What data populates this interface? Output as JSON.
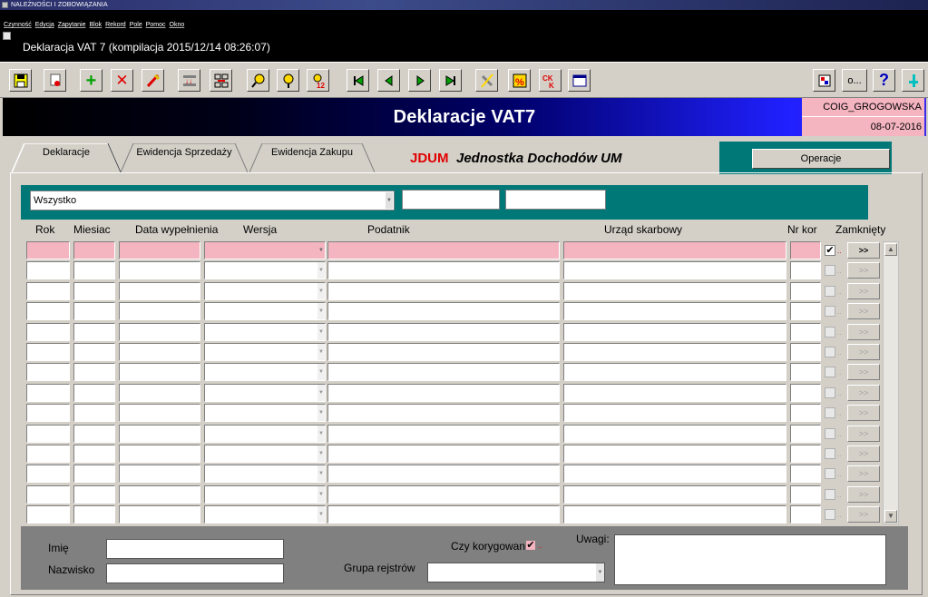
{
  "os_title": "NALEŻNOŚCI I ZOBOWIĄZANIA",
  "menu": [
    "Czynność",
    "Edycja",
    "Zapytanie",
    "Blok",
    "Rekord",
    "Pole",
    "Pomoc",
    "Okno"
  ],
  "window_title": "Deklaracja VAT 7 (kompilacja 2015/12/14 08:26:07)",
  "toolbar": {
    "buttons": [
      "save-icon",
      "print-icon",
      "add-icon",
      "delete-icon",
      "edit-icon",
      "insert-rows-icon",
      "clear-rows-icon",
      "search-icon",
      "search-alt-icon",
      "count-icon",
      "first-icon",
      "prev-icon",
      "next-icon",
      "last-icon",
      "pen-icon",
      "calc-icon",
      "ck-icon",
      "window-icon",
      "tool-icon"
    ],
    "right_label": "o...",
    "help": "?"
  },
  "banner": {
    "title": "Deklaracje VAT7",
    "user": "COIG_GROGOWSKA",
    "date": "08-07-2016"
  },
  "tabs": [
    {
      "label": "Deklaracje"
    },
    {
      "label": "Ewidencja Sprzedaży"
    },
    {
      "label": "Ewidencja Zakupu"
    }
  ],
  "org": {
    "code": "JDUM",
    "name": "Jednostka Dochodów UM"
  },
  "operations_label": "Operacje",
  "filter": {
    "selected": "Wszystko"
  },
  "columns": {
    "rok": "Rok",
    "miesiac": "Miesiac",
    "data": "Data wypełnienia",
    "wersja": "Wersja",
    "podatnik": "Podatnik",
    "urzad": "Urząd skarbowy",
    "nrkor": "Nr kor",
    "zamkniety": "Zamknięty"
  },
  "row_button": ">>",
  "checkbox_suffix": "..",
  "row_count": 14,
  "bottom": {
    "imie": "Imię",
    "nazwisko": "Nazwisko",
    "czy_korygowana": "Czy korygowana",
    "grupa": "Grupa rejstrów",
    "uwagi": "Uwagi:"
  },
  "colors": {
    "accent_teal": "#007878",
    "highlight_pink": "#f4b4c0",
    "org_code_red": "#e00000"
  }
}
